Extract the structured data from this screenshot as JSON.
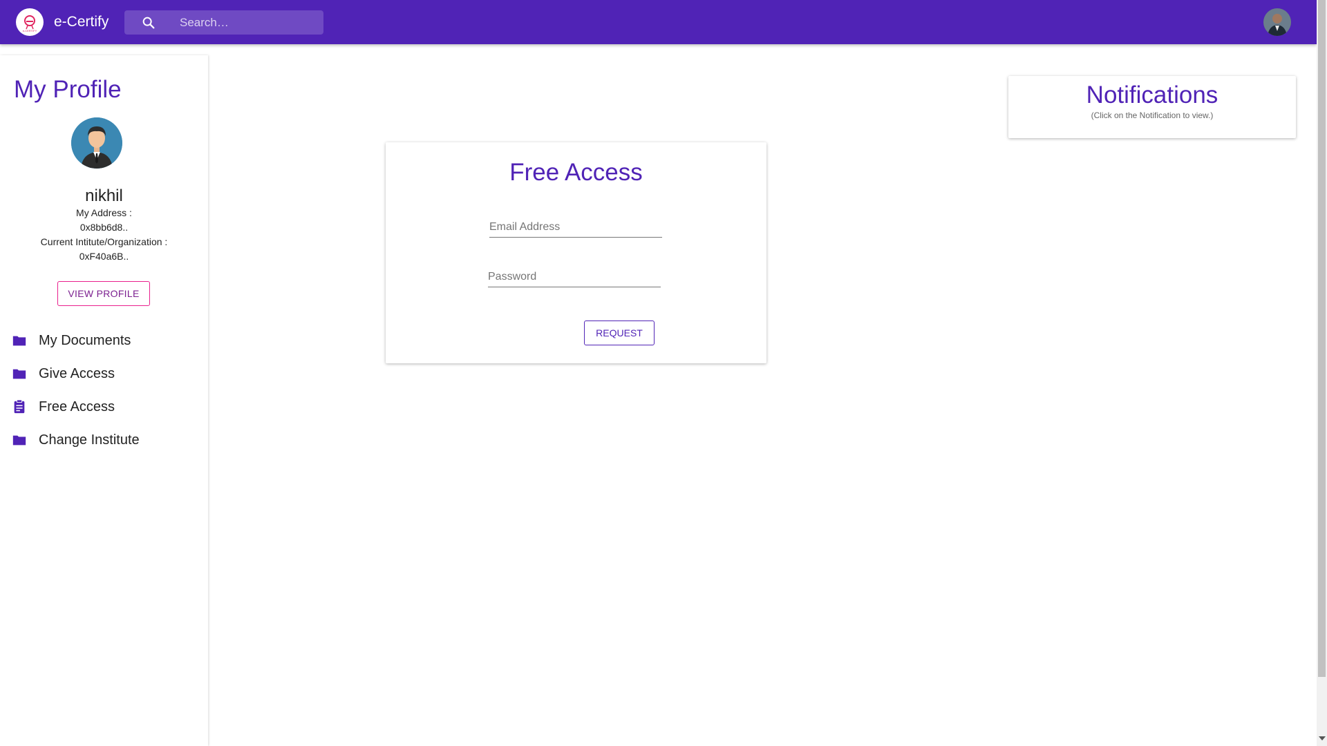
{
  "appbar": {
    "title": "e-Certify",
    "search_placeholder": "Search…",
    "logo_text": "e-CERTIFY"
  },
  "sidebar": {
    "heading": "My Profile",
    "user_name": "nikhil",
    "address_label": "My Address :",
    "address_value": "0x8bb6d8..",
    "institute_label": "Current Intitute/Organization :",
    "institute_value": "0xF40a6B..",
    "view_profile_label": "VIEW PROFILE",
    "items": [
      {
        "label": "My Documents",
        "icon": "folder-icon"
      },
      {
        "label": "Give Access",
        "icon": "folder-icon"
      },
      {
        "label": "Free Access",
        "icon": "clipboard-icon"
      },
      {
        "label": "Change Institute",
        "icon": "folder-icon"
      }
    ]
  },
  "main": {
    "card_title": "Free Access",
    "email_placeholder": "Email Address",
    "password_placeholder": "Password",
    "request_label": "REQUEST"
  },
  "notifications": {
    "title": "Notifications",
    "subtitle": "(Click on the Notification to view.)"
  },
  "colors": {
    "primary": "#5023b6",
    "accent_pink": "#e91e8c"
  }
}
